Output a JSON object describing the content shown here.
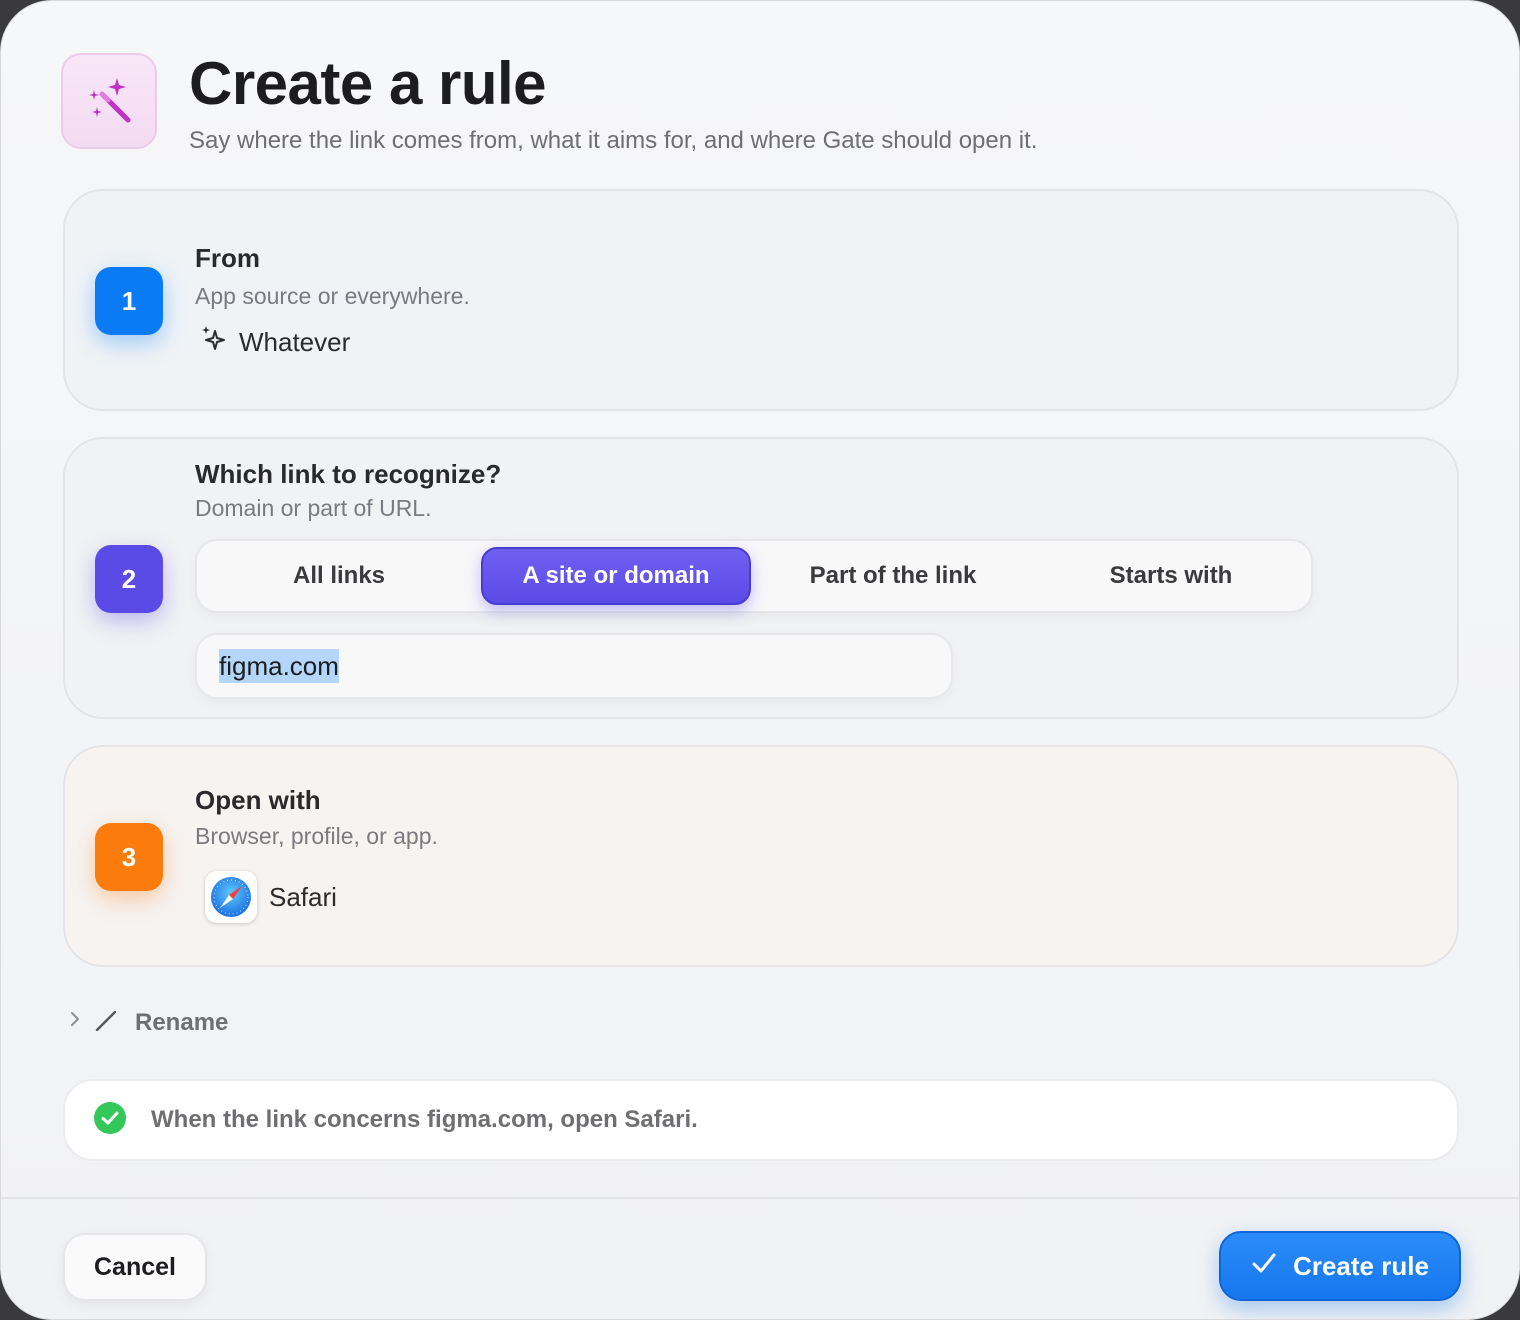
{
  "header": {
    "title": "Create a rule",
    "subtitle": "Say where the link comes from, what it aims for, and where Gate should open it.",
    "icon": "magic-wand-icon"
  },
  "steps": {
    "from": {
      "number": "1",
      "title": "From",
      "subtitle": "App source or everywhere.",
      "value": "Whatever",
      "value_icon": "sparkles-icon",
      "color": "#0a7bf5"
    },
    "match": {
      "number": "2",
      "title": "Which link to recognize?",
      "subtitle": "Domain or part of URL.",
      "options": [
        "All links",
        "A site or domain",
        "Part of the link",
        "Starts with"
      ],
      "selected": "A site or domain",
      "input_value": "figma.com",
      "color": "#5a4be6"
    },
    "open_with": {
      "number": "3",
      "title": "Open with",
      "subtitle": "Browser, profile, or app.",
      "value": "Safari",
      "value_icon": "safari-compass-icon",
      "color": "#fb7b0c"
    }
  },
  "rename": {
    "label": "Rename",
    "icons": [
      "chevron-right-icon",
      "pencil-icon"
    ]
  },
  "summary": {
    "text": "When the link concerns figma.com, open Safari.",
    "icon": "check-circle-icon",
    "status_color": "#34c759"
  },
  "footer": {
    "cancel_label": "Cancel",
    "create_label": "Create rule",
    "accent": "#1577ee"
  }
}
